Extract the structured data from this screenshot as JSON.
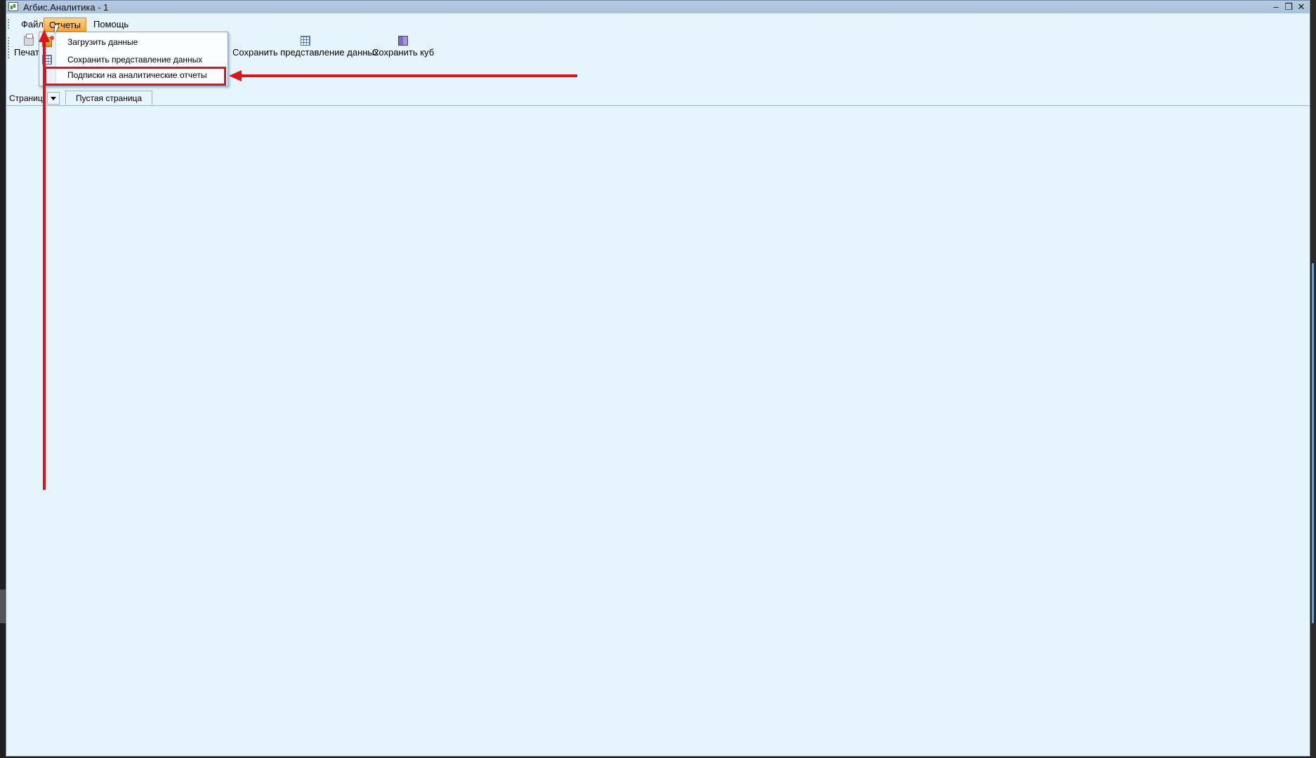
{
  "window": {
    "title": "Агбис.Аналитика - 1",
    "controls": {
      "minimize": "‒",
      "restore": "❐",
      "close": "✕"
    }
  },
  "menubar": {
    "items": [
      {
        "label": "Файл"
      },
      {
        "label": "Отчеты"
      },
      {
        "label": "Помощь"
      }
    ]
  },
  "toolbar": {
    "print_label": "Печать",
    "save_view_label": "Сохранить представление данных",
    "save_cube_label": "Сохранить куб"
  },
  "dropdown": {
    "items": [
      {
        "label": "Загрузить данные",
        "icon": "load-data-icon"
      },
      {
        "label": "Сохранить представление данных",
        "icon": "grid-icon"
      },
      {
        "label": "Подписки на аналитические отчеты",
        "icon": ""
      }
    ]
  },
  "tabs": {
    "pages_label": "Страницы",
    "active_tab": "Пустая страница"
  },
  "annotations": {
    "highlight_color": "#e0121b"
  },
  "colors": {
    "workspace_bg": "#e6f5fc",
    "menu_active": "#f7a640"
  }
}
